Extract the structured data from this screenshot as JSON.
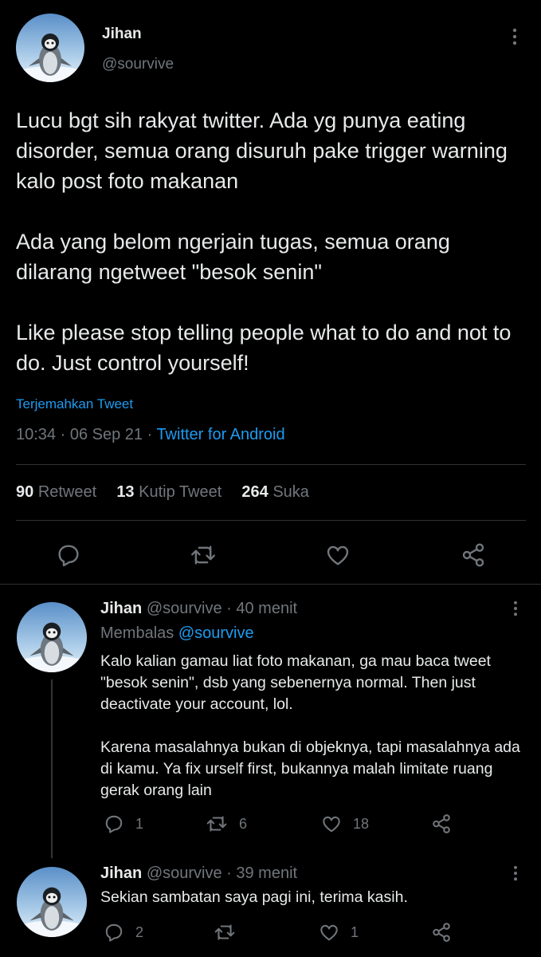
{
  "main": {
    "author": {
      "name": "Jihan",
      "handle": "@sourvive"
    },
    "paragraphs": [
      "Lucu bgt sih rakyat twitter. Ada yg punya eating disorder, semua orang disuruh pake trigger warning kalo post foto makanan",
      "Ada yang belom ngerjain tugas, semua orang dilarang ngetweet \"besok senin\"",
      "Like please stop telling people what to do and not to do. Just control yourself!"
    ],
    "translate_label": "Terjemahkan Tweet",
    "time": "10:34 · 06 Sep 21 ·",
    "source": "Twitter for Android",
    "stats": {
      "retweets": "90",
      "retweets_label": "Retweet",
      "quotes": "13",
      "quotes_label": "Kutip Tweet",
      "likes": "264",
      "likes_label": "Suka"
    }
  },
  "replies": [
    {
      "name": "Jihan",
      "handle": "@sourvive",
      "time": "· 40 menit",
      "replying_label": "Membalas",
      "replying_to": "@sourvive",
      "paragraphs": [
        "Kalo kalian gamau liat foto makanan, ga mau baca tweet \"besok senin\", dsb yang sebenernya normal. Then just deactivate your account, lol.",
        "Karena masalahnya bukan di objeknya, tapi masalahnya ada di kamu. Ya fix urself first, bukannya malah limitate ruang gerak orang lain"
      ],
      "counts": {
        "reply": "1",
        "retweet": "6",
        "like": "18"
      }
    },
    {
      "name": "Jihan",
      "handle": "@sourvive",
      "time": "· 39 menit",
      "text": "Sekian sambatan saya pagi ini, terima kasih.",
      "counts": {
        "reply": "2",
        "retweet": "",
        "like": "1"
      }
    }
  ],
  "colors": {
    "background": "#000000",
    "text": "#d9d9d9",
    "muted": "#71767b",
    "link": "#1d9bf0",
    "divider": "#2f3336"
  },
  "icons": [
    "more-vertical-icon",
    "reply-icon",
    "retweet-icon",
    "like-icon",
    "share-icon",
    "avatar-penguin"
  ]
}
